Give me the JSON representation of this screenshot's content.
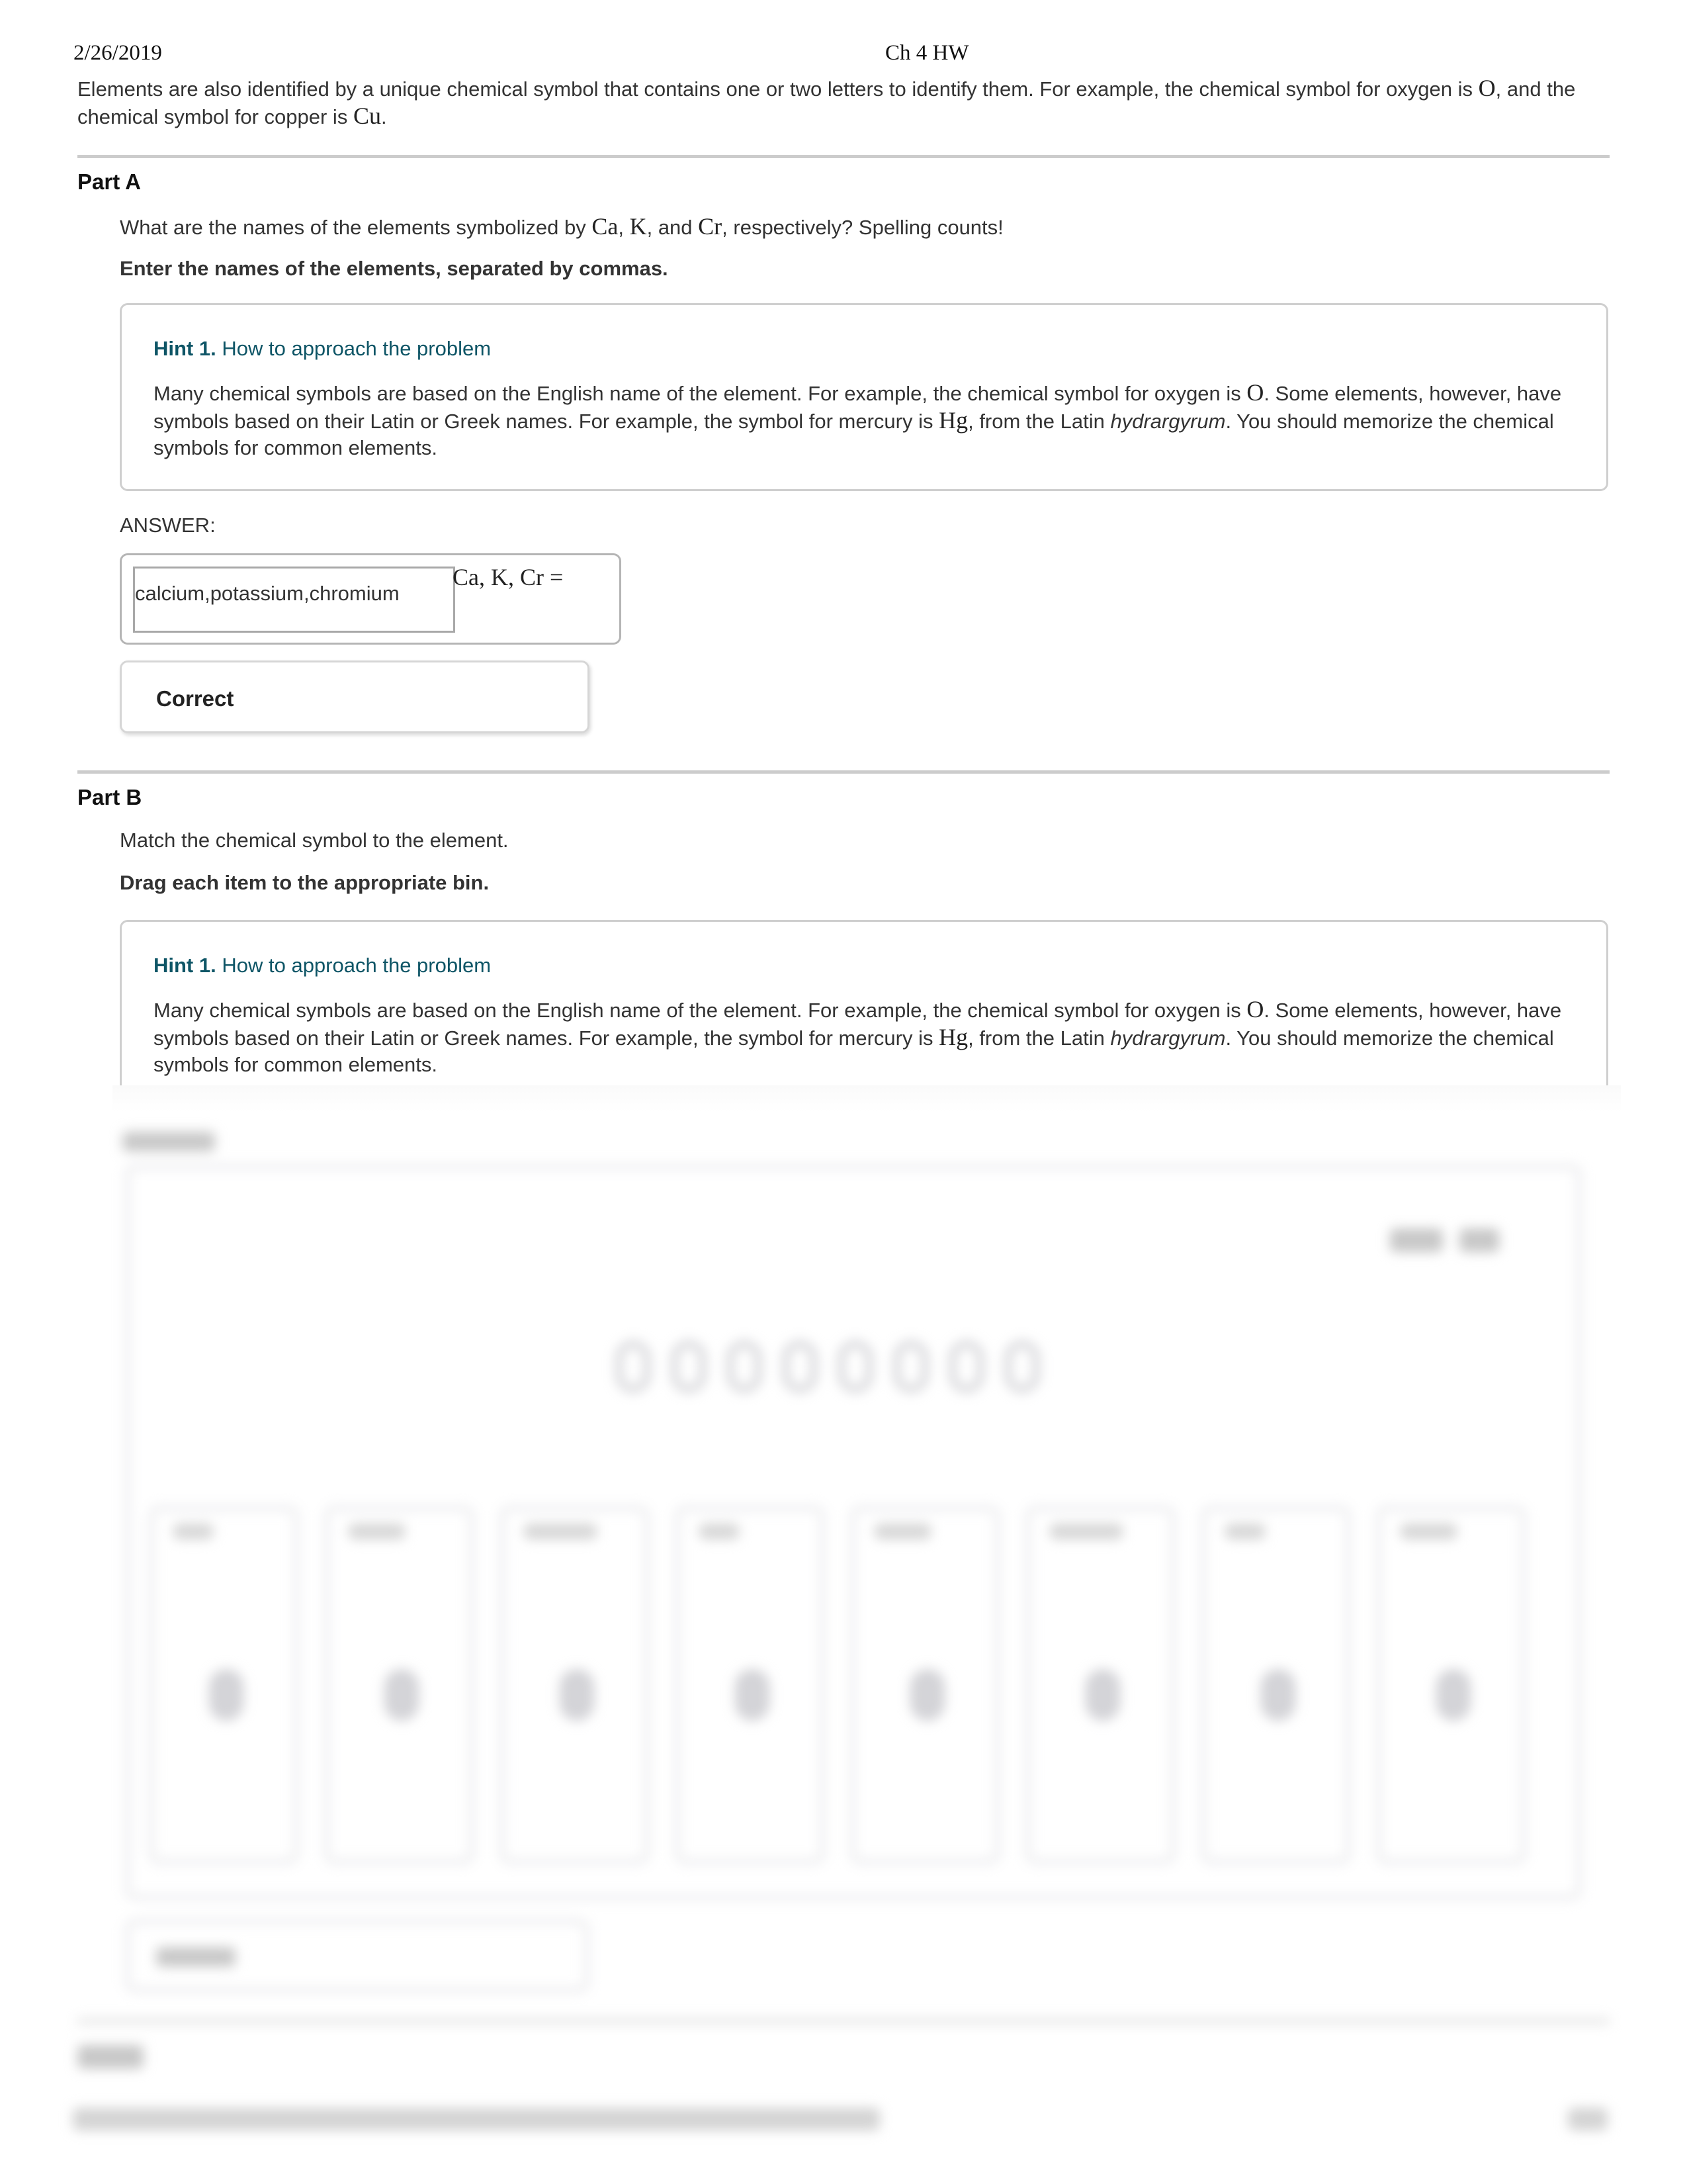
{
  "header": {
    "date": "2/26/2019",
    "title": "Ch 4 HW"
  },
  "intro": {
    "text_1": "Elements are also identified by a unique chemical symbol that contains one or two letters to identify them. For example, the chemical symbol for oxygen is ",
    "sym_1": "O",
    "text_2": ", and the chemical symbol for copper is ",
    "sym_2": "Cu",
    "text_3": "."
  },
  "part_a": {
    "title": "Part A",
    "question": {
      "t1": "What are the names of the elements symbolized by ",
      "s1": "Ca",
      "t2": ", ",
      "s2": "K",
      "t3": ", and ",
      "s3": "Cr",
      "t4": ", respectively? Spelling counts!"
    },
    "instruction": "Enter the names of the elements, separated by commas.",
    "hint": {
      "number": "Hint 1.",
      "title": "How to approach the problem",
      "b1": "Many chemical symbols are based on the English name of the element. For example, the chemical symbol for oxygen is ",
      "s1": "O",
      "b2": ". Some elements, however, have symbols based on their Latin or Greek names. For example, the symbol for mercury is ",
      "s2": "Hg",
      "b3": ", from the Latin ",
      "latin": "hydrargyrum",
      "b4": ". You should memorize the chemical symbols for common elements."
    },
    "answer_label": "ANSWER:",
    "answer_value": "calcium,potassium,chromium",
    "answer_math": "Ca, K, Cr =",
    "feedback": "Correct"
  },
  "part_b": {
    "title": "Part B",
    "question": "Match the chemical symbol to the element.",
    "instruction": "Drag each item to the appropriate bin.",
    "hint": {
      "number": "Hint 1.",
      "title": "How to approach the problem",
      "b1": "Many chemical symbols are based on the English name of the element. For example, the chemical symbol for oxygen is ",
      "s1": "O",
      "b2": ". Some elements, however, have symbols based on their Latin or Greek names. For example, the symbol for mercury is ",
      "s2": "Hg",
      "b3": ", from the Latin ",
      "latin": "hydrargyrum",
      "b4": ". You should memorize the chemical symbols for common elements."
    },
    "blurred_content": {
      "draggable_item_count": 8,
      "bin_count": 8,
      "toolbar_button_count": 2
    }
  },
  "colors": {
    "hint_title": "#0e5566",
    "rule": "#cccccc",
    "text": "#333333"
  }
}
